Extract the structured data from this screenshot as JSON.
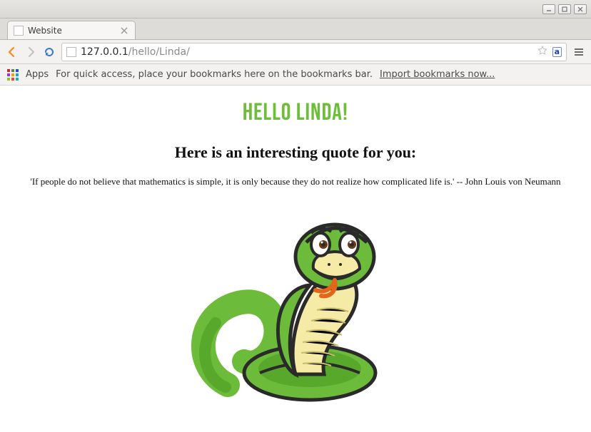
{
  "window": {
    "controls": {
      "minimize": "—",
      "maximize": "⬜",
      "close": "×"
    }
  },
  "browser": {
    "tab": {
      "title": "Website"
    },
    "address": {
      "host": "127.0.0.1",
      "path": "/hello/Linda/"
    },
    "translate_badge": "a"
  },
  "bookmarks": {
    "apps_label": "Apps",
    "hint": "For quick access, place your bookmarks here on the bookmarks bar.",
    "import_link": "Import bookmarks now..."
  },
  "page": {
    "greeting": "Hello Linda!",
    "subhead": "Here is an interesting quote for you:",
    "quote": "'If people do not believe that mathematics is simple, it is only because they do not realize how complicated life is.' -- John Louis von Neumann"
  }
}
